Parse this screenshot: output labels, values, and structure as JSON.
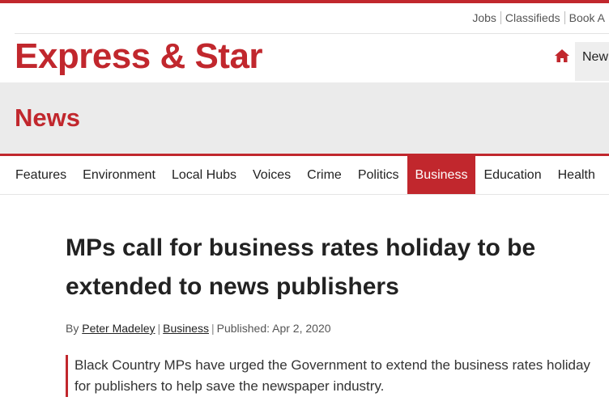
{
  "utility_links": [
    "Jobs",
    "Classifieds",
    "Book A"
  ],
  "brand": {
    "logo_text": "Express & Star",
    "color": "#c1272d"
  },
  "header_nav": {
    "home_icon": "home-icon",
    "active_label": "New"
  },
  "section": {
    "title": "News"
  },
  "subnav": {
    "items": [
      "Features",
      "Environment",
      "Local Hubs",
      "Voices",
      "Crime",
      "Politics",
      "Business",
      "Education",
      "Health"
    ],
    "active": "Business"
  },
  "article": {
    "headline": "MPs call for business rates holiday to be extended to news publishers",
    "byline": {
      "prefix": "By",
      "author": "Peter Madeley",
      "category": "Business",
      "published_label": "Published:",
      "date": "Apr 2, 2020"
    },
    "standfirst": "Black Country MPs have urged the Government to extend the business rates holiday for publishers to help save the newspaper industry."
  }
}
